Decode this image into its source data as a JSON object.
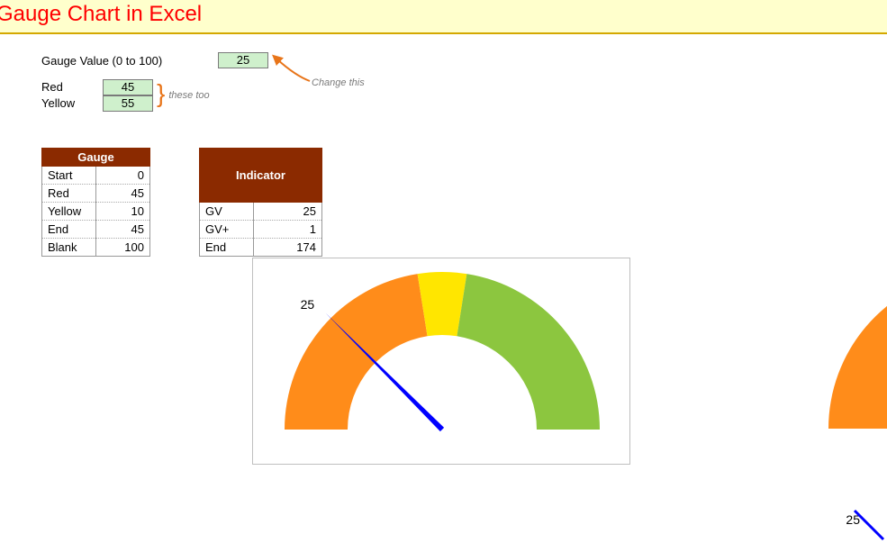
{
  "header": {
    "title": "Gauge Chart in Excel"
  },
  "inputs": {
    "gauge_label": "Gauge Value (0 to 100)",
    "gauge_value": "25",
    "change_this": "Change this",
    "red_label": "Red",
    "red_value": "45",
    "yellow_label": "Yellow",
    "yellow_value": "55",
    "these_too": "these too"
  },
  "tables": {
    "gauge": {
      "title": "Gauge",
      "rows": [
        {
          "k": "Start",
          "v": "0"
        },
        {
          "k": "Red",
          "v": "45"
        },
        {
          "k": "Yellow",
          "v": "10"
        },
        {
          "k": "End",
          "v": "45"
        },
        {
          "k": "Blank",
          "v": "100"
        }
      ]
    },
    "indicator": {
      "title": "Indicator",
      "rows": [
        {
          "k": "GV",
          "v": "25"
        },
        {
          "k": "GV+",
          "v": "1"
        },
        {
          "k": "End",
          "v": "174"
        }
      ]
    }
  },
  "chart": {
    "needle_label": "25"
  },
  "partial": {
    "label": "25"
  },
  "chart_data": {
    "type": "pie",
    "title": "Gauge Chart in Excel",
    "series": [
      {
        "name": "Gauge",
        "categories": [
          "Start",
          "Red",
          "Yellow",
          "End",
          "Blank"
        ],
        "values": [
          0,
          45,
          10,
          45,
          100
        ],
        "colors": [
          "",
          "#ff8c1a",
          "#ffe600",
          "#8cc63f",
          "transparent"
        ]
      },
      {
        "name": "Indicator",
        "categories": [
          "GV",
          "GV+",
          "End"
        ],
        "values": [
          25,
          1,
          174
        ],
        "colors": [
          "transparent",
          "#0000ff",
          "transparent"
        ]
      }
    ],
    "gauge_value": 25,
    "range": [
      0,
      100
    ],
    "needle_color": "#0000ff"
  }
}
